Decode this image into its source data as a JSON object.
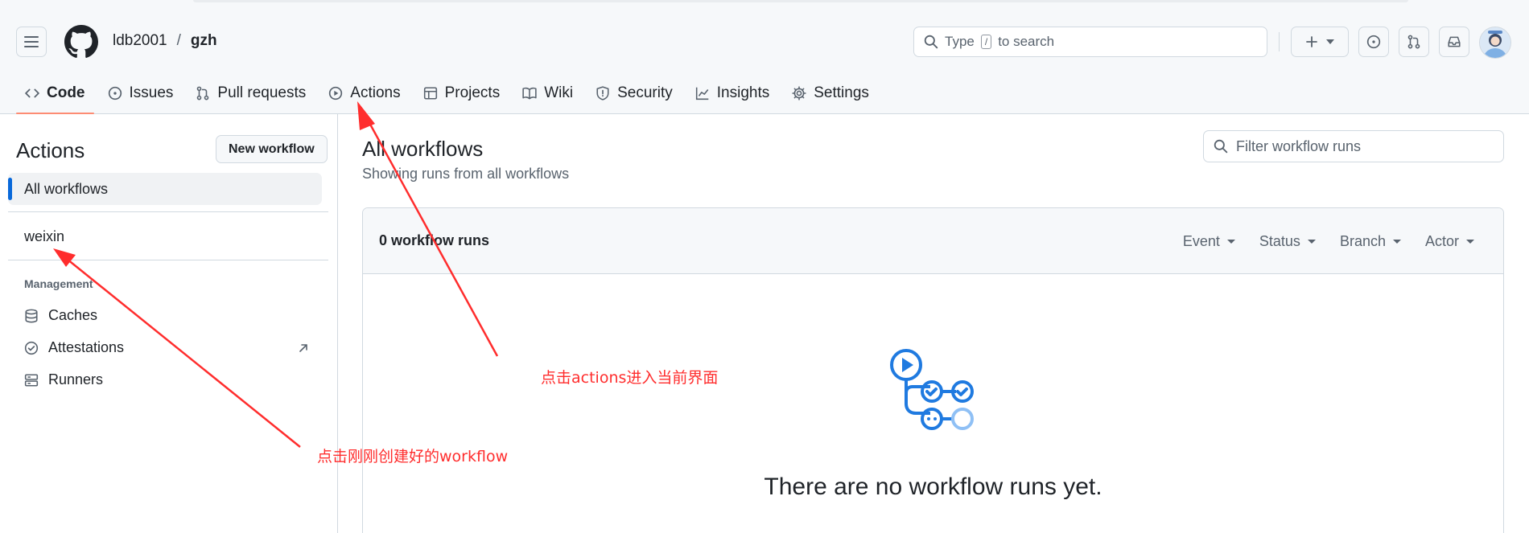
{
  "header": {
    "owner": "ldb2001",
    "separator": "/",
    "repo": "gzh",
    "search_prefix": "Type",
    "search_key": "/",
    "search_suffix": "to search"
  },
  "tabs": [
    {
      "label": "Code",
      "icon": "code-icon",
      "selected": true
    },
    {
      "label": "Issues",
      "icon": "issue-icon"
    },
    {
      "label": "Pull requests",
      "icon": "pull-request-icon"
    },
    {
      "label": "Actions",
      "icon": "play-icon"
    },
    {
      "label": "Projects",
      "icon": "table-icon"
    },
    {
      "label": "Wiki",
      "icon": "book-icon"
    },
    {
      "label": "Security",
      "icon": "shield-icon"
    },
    {
      "label": "Insights",
      "icon": "graph-icon"
    },
    {
      "label": "Settings",
      "icon": "gear-icon"
    }
  ],
  "sidebar": {
    "title": "Actions",
    "new_workflow": "New workflow",
    "all_workflows": "All workflows",
    "workflow_item": "weixin",
    "management_heading": "Management",
    "links": [
      {
        "label": "Caches",
        "icon": "database-icon"
      },
      {
        "label": "Attestations",
        "icon": "verified-icon"
      },
      {
        "label": "Runners",
        "icon": "server-icon"
      }
    ]
  },
  "main": {
    "title": "All workflows",
    "subtitle": "Showing runs from all workflows",
    "filter_placeholder": "Filter workflow runs",
    "runs_count": "0 workflow runs",
    "filters": [
      "Event",
      "Status",
      "Branch",
      "Actor"
    ],
    "empty_message": "There are no workflow runs yet."
  },
  "annotations": {
    "actions_note": "点击actions进入当前界面",
    "workflow_note": "点击刚刚创建好的workflow",
    "color": "#ff2d2d"
  },
  "colors": {
    "accent": "#0969da",
    "tab_underline": "#fd8c73",
    "empty_icon": "#1f7ae0"
  }
}
